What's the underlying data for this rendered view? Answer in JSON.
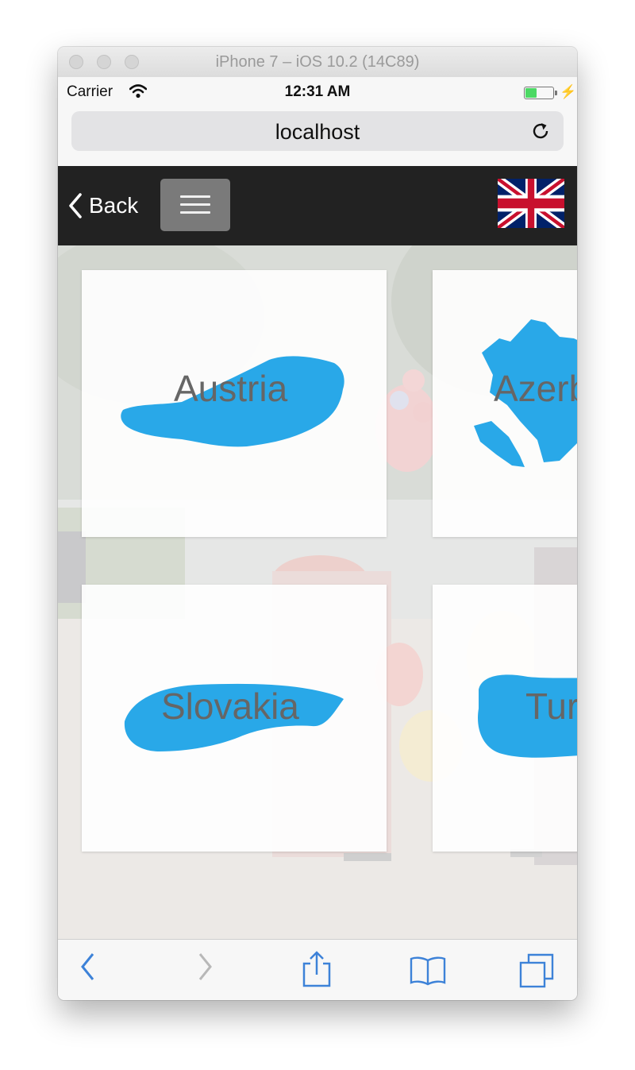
{
  "window": {
    "title": "iPhone 7 – iOS 10.2 (14C89)",
    "traffic_lights": [
      "close",
      "minimize",
      "zoom"
    ]
  },
  "statusbar": {
    "carrier": "Carrier",
    "time": "12:31 AM",
    "battery_level": 0.4
  },
  "browser": {
    "url": "localhost",
    "toolbar": [
      "back-icon",
      "forward-icon",
      "share-icon",
      "bookmarks-icon",
      "tabs-icon"
    ]
  },
  "navbar": {
    "back_label": "Back",
    "language_flag": "uk-flag-icon"
  },
  "countries": [
    {
      "name": "Austria"
    },
    {
      "name": "Azerbaijan"
    },
    {
      "name": "Slovakia"
    },
    {
      "name": "Turkey"
    }
  ],
  "colors": {
    "accent": "#29a8e8",
    "navbar": "#222222",
    "ios_blue": "#3d82d8",
    "tile_label": "#666666"
  }
}
